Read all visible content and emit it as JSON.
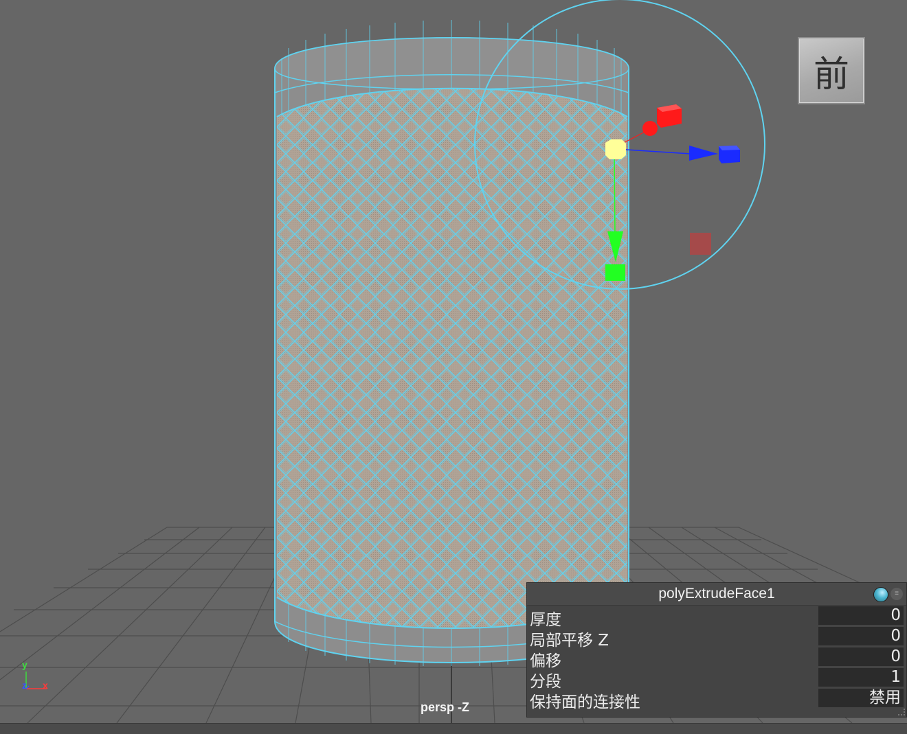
{
  "viewport": {
    "camera_label": "persp -Z",
    "view_cube_label": "前",
    "axis_labels": {
      "y": "y",
      "z": "z",
      "x": "x"
    },
    "colors": {
      "background": "#666666",
      "selection_wire": "#5fd3f0",
      "grid": "#4a4a4a",
      "face_fill": "#b0a396",
      "gizmo_x": "#ff1a1a",
      "gizmo_y": "#22ff22",
      "gizmo_z": "#1a2bff",
      "gizmo_center": "#ffff99"
    },
    "icons": [
      "view-cube",
      "move-manipulator",
      "axis-indicator"
    ]
  },
  "inview_editor": {
    "title": "polyExtrudeFace1",
    "icons": [
      "sphere-toggle-icon",
      "menu-icon"
    ],
    "attributes": [
      {
        "label": "厚度",
        "value": "0"
      },
      {
        "label": "局部平移 Z",
        "value": "0"
      },
      {
        "label": "偏移",
        "value": "0"
      },
      {
        "label": "分段",
        "value": "1"
      },
      {
        "label": "保持面的连接性",
        "value": "禁用"
      }
    ]
  }
}
